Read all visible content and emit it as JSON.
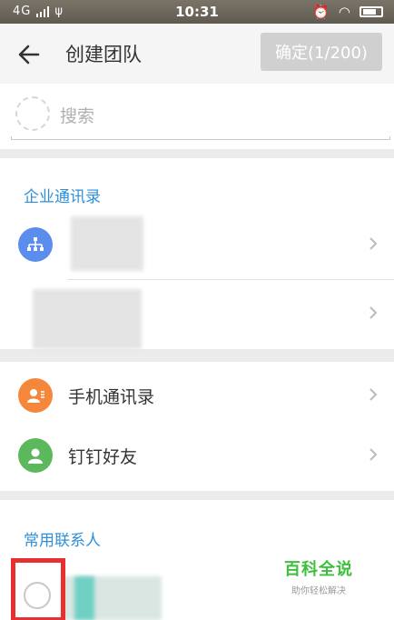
{
  "status_bar": {
    "network": "4G",
    "time": "10:31"
  },
  "header": {
    "title": "创建团队",
    "confirm_label": "确定(1/200)"
  },
  "search": {
    "placeholder": "搜索"
  },
  "enterprise_section": {
    "title": "企业通讯录"
  },
  "contacts_section": {
    "items": [
      {
        "label": "手机通讯录",
        "icon": "phone-contacts-icon",
        "color": "#f5873b"
      },
      {
        "label": "钉钉好友",
        "icon": "dingtalk-friends-icon",
        "color": "#5cb85c"
      }
    ]
  },
  "frequent_section": {
    "title": "常用联系人"
  },
  "watermark": {
    "title": "百科全说",
    "subtitle": "助你轻松解决"
  },
  "colors": {
    "accent_blue": "#2f8fd8",
    "org_icon_blue": "#5b8dee",
    "highlight_red": "#e83030"
  }
}
